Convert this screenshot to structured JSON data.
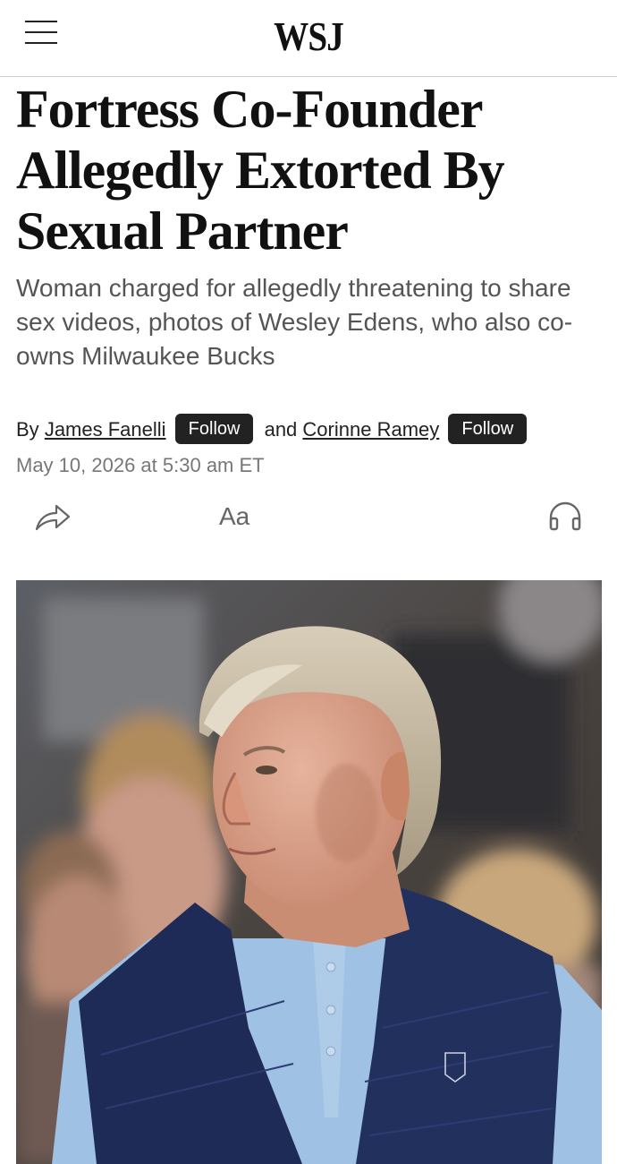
{
  "header": {
    "menu_icon": "hamburger-menu-icon",
    "logo": "WSJ"
  },
  "article": {
    "headline": "Fortress Co-Founder Allegedly Extorted By Sexual Partner",
    "dek": "Woman charged for allegedly threatening to share sex videos, photos of Wesley Edens, who also co-owns Milwaukee Bucks",
    "byline": {
      "prefix": "By",
      "author1": "James Fanelli",
      "follow1": "Follow",
      "conjunction": "and",
      "author2": "Corinne Ramey",
      "follow2": "Follow"
    },
    "timestamp": "May 10, 2026 at 5:30 am ET"
  },
  "toolbar": {
    "share_icon": "share-arrow-icon",
    "font_size_label": "Aa",
    "listen_icon": "headphones-icon"
  },
  "colors": {
    "follow_button_bg": "#222222",
    "vest_navy": "#1f2b57",
    "shirt_blue": "#9fc1e3"
  }
}
